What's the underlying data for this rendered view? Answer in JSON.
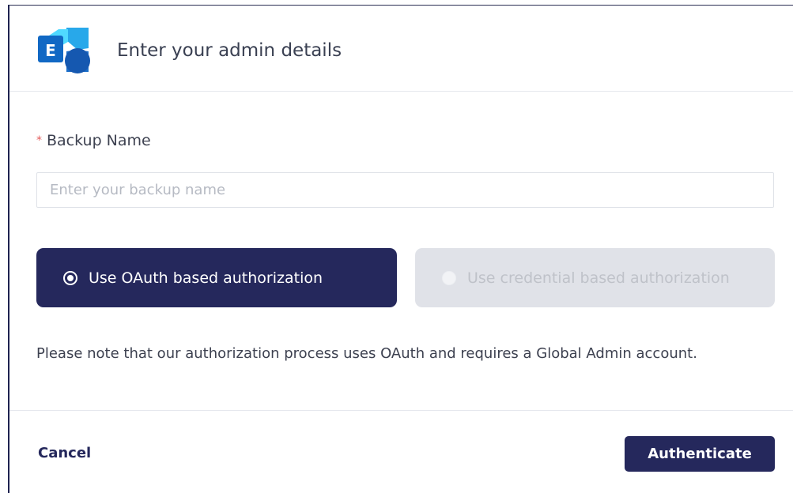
{
  "header": {
    "logo_icon": "exchange-logo-icon",
    "logo_letter": "E",
    "title": "Enter your admin details"
  },
  "form": {
    "required_mark": "*",
    "backup_name_label": "Backup Name",
    "backup_name_value": "",
    "backup_name_placeholder": "Enter your backup name"
  },
  "auth_options": {
    "oauth_label": "Use OAuth based authorization",
    "oauth_selected": true,
    "credential_label": "Use credential based authorization",
    "credential_selected": false
  },
  "note": "Please note that our authorization process uses OAuth and requires a Global Admin account.",
  "footer": {
    "cancel_label": "Cancel",
    "authenticate_label": "Authenticate"
  },
  "colors": {
    "primary": "#25285c",
    "required": "#e35d5d",
    "disabled_bg": "#e0e2e8",
    "logo_blue": "#1c6fc9",
    "logo_light": "#4cc2f0"
  }
}
